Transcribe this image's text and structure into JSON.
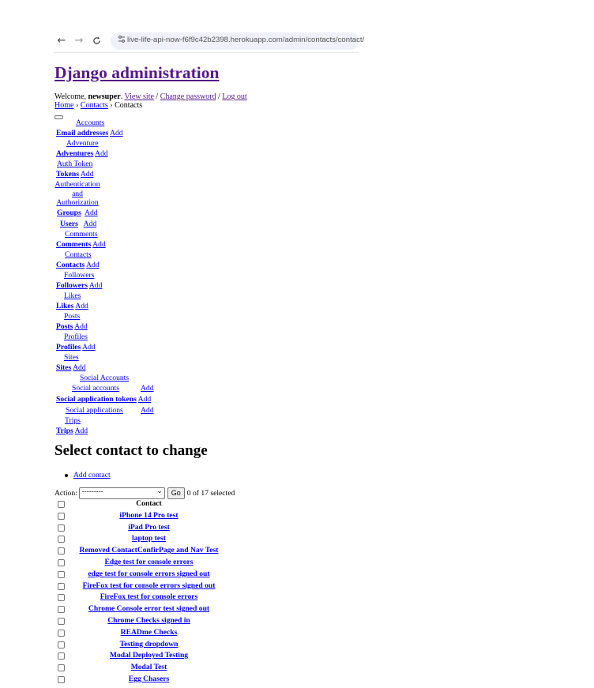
{
  "browser": {
    "back_icon": "←",
    "forward_icon": "→",
    "reload_icon": "C",
    "url": "live-life-api-now-f6f9c42b2398.herokuapp.com/admin/contacts/contact/"
  },
  "header": {
    "site_name": "Django administration",
    "welcome": "Welcome,",
    "username": "newsuper",
    "links": [
      "View site",
      "Change password",
      "Log out"
    ],
    "sep": "/"
  },
  "breadcrumbs": [
    "Home",
    "Contacts",
    "Contacts"
  ],
  "sidebar": {
    "add_label": "Add",
    "apps": [
      {
        "caption": "Accounts",
        "models": [
          {
            "name": "Email addresses"
          }
        ]
      },
      {
        "caption": "Adventure",
        "models": [
          {
            "name": "Adventures"
          }
        ]
      },
      {
        "caption": "Auth Token",
        "models": [
          {
            "name": "Tokens"
          }
        ]
      },
      {
        "caption": "Authentication and Authorization",
        "models": [
          {
            "name": "Groups"
          },
          {
            "name": "Users"
          }
        ]
      },
      {
        "caption": "Comments",
        "models": [
          {
            "name": "Comments"
          }
        ]
      },
      {
        "caption": "Contacts",
        "models": [
          {
            "name": "Contacts"
          }
        ]
      },
      {
        "caption": "Followers",
        "models": [
          {
            "name": "Followers"
          }
        ]
      },
      {
        "caption": "Likes",
        "models": [
          {
            "name": "Likes"
          }
        ]
      },
      {
        "caption": "Posts",
        "models": [
          {
            "name": "Posts"
          }
        ]
      },
      {
        "caption": "Profiles",
        "models": [
          {
            "name": "Profiles"
          }
        ]
      },
      {
        "caption": "Sites",
        "models": [
          {
            "name": "Sites"
          }
        ]
      },
      {
        "caption": "Social Accounts",
        "models": [
          {
            "name": "Social accounts"
          },
          {
            "name": "Social application tokens"
          },
          {
            "name": "Social applications"
          }
        ]
      },
      {
        "caption": "Trips",
        "models": [
          {
            "name": "Trips"
          }
        ]
      }
    ]
  },
  "main": {
    "title": "Select contact to change",
    "add_button": "Add contact",
    "action_label": "Action:",
    "action_selected": "---------",
    "go_label": "Go",
    "counter": "0 of 17 selected",
    "column_header": "Contact",
    "rows": [
      "iPhone 14 Pro test",
      "iPad Pro test",
      "laptop test",
      "Removed ContactConfirPage and Nav Test",
      "Edge test for console errors",
      "edge test for console errors signed out",
      "FireFox test for console errors signed out",
      "FireFox test for console errors",
      "Chrome Console error test signed out",
      "Chrome Checks signed in",
      "READme Checks",
      "Testing dropdown",
      "Modal Deployed Testing",
      "Modal Test",
      "Egg Chasers"
    ]
  }
}
